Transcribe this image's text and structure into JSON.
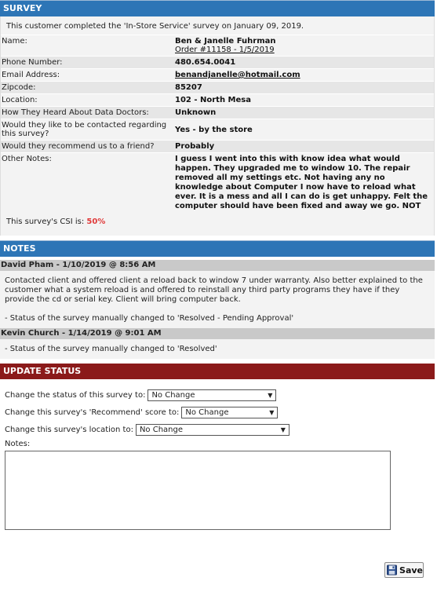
{
  "survey": {
    "header": "SURVEY",
    "intro": "This customer completed the 'In-Store Service' survey on January 09, 2019.",
    "fields": [
      {
        "label": "Name:",
        "value": "Ben & Janelle Fuhrman",
        "sub": "Order #11158 - 1/5/2019"
      },
      {
        "label": "Phone Number:",
        "value": "480.654.0041"
      },
      {
        "label": "Email Address:",
        "value": "benandjanelle@hotmail.com"
      },
      {
        "label": "Zipcode:",
        "value": "85207"
      },
      {
        "label": "Location:",
        "value": "102 - North Mesa"
      },
      {
        "label": "How They Heard About Data Doctors:",
        "value": "Unknown"
      },
      {
        "label": "Would they like to be contacted regarding this survey?",
        "value": "Yes - by the store"
      },
      {
        "label": "Would they recommend us to a friend?",
        "value": "Probably"
      },
      {
        "label": "Other Notes:",
        "value": "I guess I went into this with know idea what would happen. They upgraded me to window 10. The repair removed all my settings etc. Not having any no knowledge about Computer I now have to reload what ever. It is a mess and all I can do is get unhappy. Felt the computer should have been fixed and away we go. NOT"
      }
    ],
    "csi_label": "This survey's CSI is:",
    "csi_value": "50%",
    "csi_color": "#e03a3a"
  },
  "notes": {
    "header": "NOTES",
    "entries": [
      {
        "author": "David Pham - 1/10/2019 @ 8:56 AM",
        "text": "Contacted client and offered client a reload back to window 7 under warranty. Also better explained to the customer what a system reload is and offered to reinstall any third party programs they have if they provide the cd or serial key. Client will bring computer back.",
        "status": "- Status of the survey manually changed to 'Resolved - Pending Approval'"
      },
      {
        "author": "Kevin Church - 1/14/2019 @ 9:01 AM",
        "status": "- Status of the survey manually changed to 'Resolved'"
      }
    ]
  },
  "update": {
    "header": "UPDATE STATUS",
    "status_label": "Change the status of this survey to:",
    "status_value": "No Change",
    "recommend_label": "Change this survey's 'Recommend' score to:",
    "recommend_value": "No Change",
    "location_label": "Change this survey's location to:",
    "location_value": "No Change",
    "notes_label": "Notes:",
    "save_label": "Save"
  },
  "colors": {
    "header_blue": "#2d75b6",
    "header_red": "#8b1a1a"
  },
  "icons": {
    "save": "floppy-disk-icon",
    "dropdown": "chevron-down-icon"
  }
}
